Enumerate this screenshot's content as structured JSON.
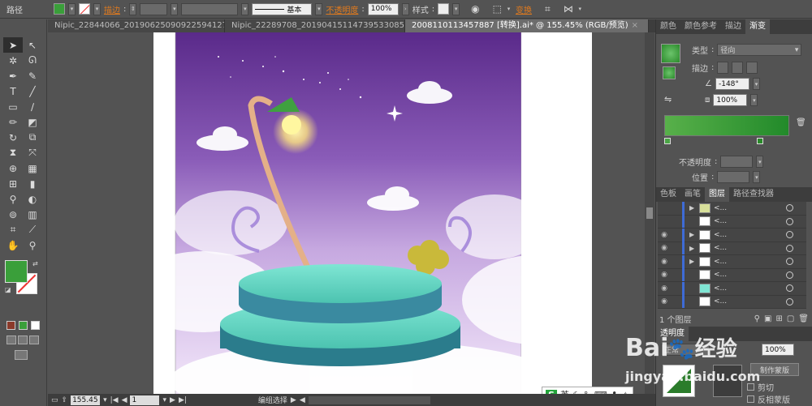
{
  "control_bar": {
    "object_type": "路径",
    "stroke_label": "描边",
    "brush_profile": "基本",
    "opacity_label": "不透明度",
    "opacity_value": "100%",
    "style_label": "样式",
    "transform_label": "变换"
  },
  "doc_tabs": [
    {
      "label": "Nipic_22844066_20190625090922594127.ai*",
      "close": "×",
      "active": false
    },
    {
      "label": "Nipic_22289708_20190415114739533085.ai*",
      "close": "×",
      "active": false
    },
    {
      "label": "20081101134578​87 [转换].ai* @ 155.45% (RGB/预览)",
      "close": "×",
      "active": true
    }
  ],
  "status_bar": {
    "zoom": "155.45",
    "page": "1",
    "status_text": "编组选择"
  },
  "ime_bar": {
    "lang": "英"
  },
  "gradient_panel": {
    "tabs": [
      "颜色",
      "颜色参考",
      "描边",
      "渐变"
    ],
    "type_label": "类型",
    "type_value": "径向",
    "stroke_label": "描边",
    "angle_value": "-148°",
    "aspect_value": "100%",
    "opacity_label": "不透明度",
    "position_label": "位置"
  },
  "layers_panel": {
    "tabs": [
      "色板",
      "画笔",
      "图层",
      "路径查找器"
    ],
    "rows": [
      {
        "name": "<...",
        "eye": false,
        "expand": true
      },
      {
        "name": "<...",
        "eye": false,
        "expand": false
      },
      {
        "name": "<...",
        "eye": true,
        "expand": true
      },
      {
        "name": "<...",
        "eye": true,
        "expand": true
      },
      {
        "name": "<...",
        "eye": true,
        "expand": true
      },
      {
        "name": "<...",
        "eye": true,
        "expand": false
      },
      {
        "name": "<...",
        "eye": true,
        "expand": false
      },
      {
        "name": "<...",
        "eye": true,
        "expand": false
      }
    ],
    "footer": "1 个图层"
  },
  "transparency_panel": {
    "tab": "透明度",
    "blend_value": "正常",
    "opacity_value": "100%",
    "make_mask": "制作蒙版",
    "clip": "剪切",
    "invert_mask": "反相蒙版"
  },
  "watermark": {
    "brand": "Bai",
    "brand2": "经验",
    "url": "jingyan.baidu.com"
  },
  "colors": {
    "fill": "#3a9f3a",
    "accent": "#e07a1e",
    "sky_top": "#5a2a8a",
    "platform": "#5ecdb8"
  }
}
